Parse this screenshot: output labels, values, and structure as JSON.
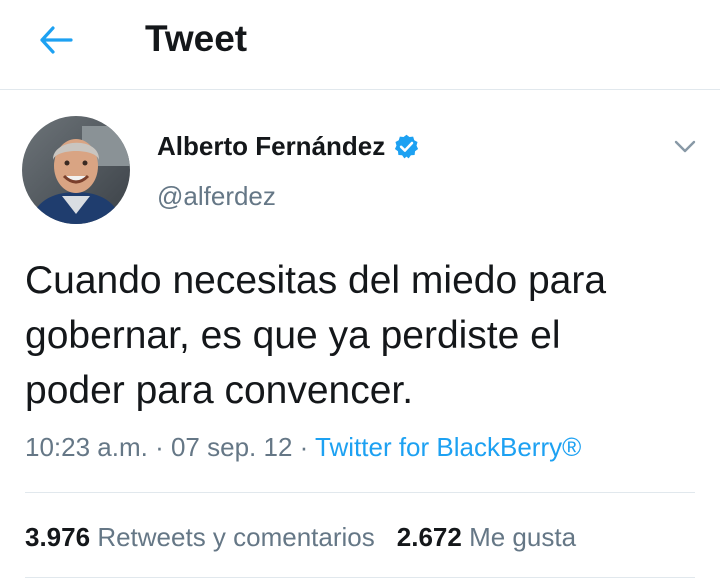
{
  "header": {
    "back_icon": "arrow-left-icon",
    "title": "Tweet"
  },
  "colors": {
    "accent": "#1da1f2",
    "text_primary": "#14171a",
    "text_secondary": "#657786",
    "divider": "#e1e8ed"
  },
  "tweet": {
    "author": {
      "name": "Alberto Fernández",
      "handle": "@alferdez",
      "verified": true,
      "verified_icon": "verified-badge-icon",
      "avatar_icon": "avatar"
    },
    "menu_icon": "chevron-down-icon",
    "text": "Cuando necesitas del miedo para\ngobernar, es que ya perdiste el\npoder para convencer.",
    "time": "10:23 a.m.",
    "separator": " · ",
    "date": "07 sep. 12",
    "source": "Twitter for BlackBerry®"
  },
  "stats": {
    "retweets_count": "3.976",
    "retweets_label": "Retweets y comentarios",
    "likes_count": "2.672",
    "likes_label": "Me gusta"
  }
}
